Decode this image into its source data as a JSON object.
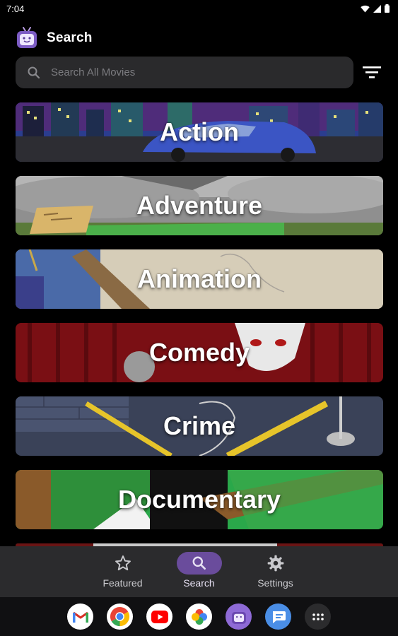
{
  "status": {
    "time": "7:04"
  },
  "header": {
    "title": "Search"
  },
  "search": {
    "placeholder": "Search All Movies"
  },
  "genres": [
    {
      "label": "Action"
    },
    {
      "label": "Adventure"
    },
    {
      "label": "Animation"
    },
    {
      "label": "Comedy"
    },
    {
      "label": "Crime"
    },
    {
      "label": "Documentary"
    }
  ],
  "nav": [
    {
      "label": "Featured",
      "icon": "star-icon",
      "active": false
    },
    {
      "label": "Search",
      "icon": "search-icon",
      "active": true
    },
    {
      "label": "Settings",
      "icon": "gear-icon",
      "active": false
    }
  ],
  "dock": [
    "gmail-icon",
    "chrome-icon",
    "youtube-icon",
    "photos-icon",
    "movie-app-icon",
    "messages-icon",
    "app-drawer-icon"
  ],
  "colors": {
    "accent": "#6a4c9c",
    "nav_bg": "#2b2b2d",
    "search_bg": "#2a2a2c"
  }
}
